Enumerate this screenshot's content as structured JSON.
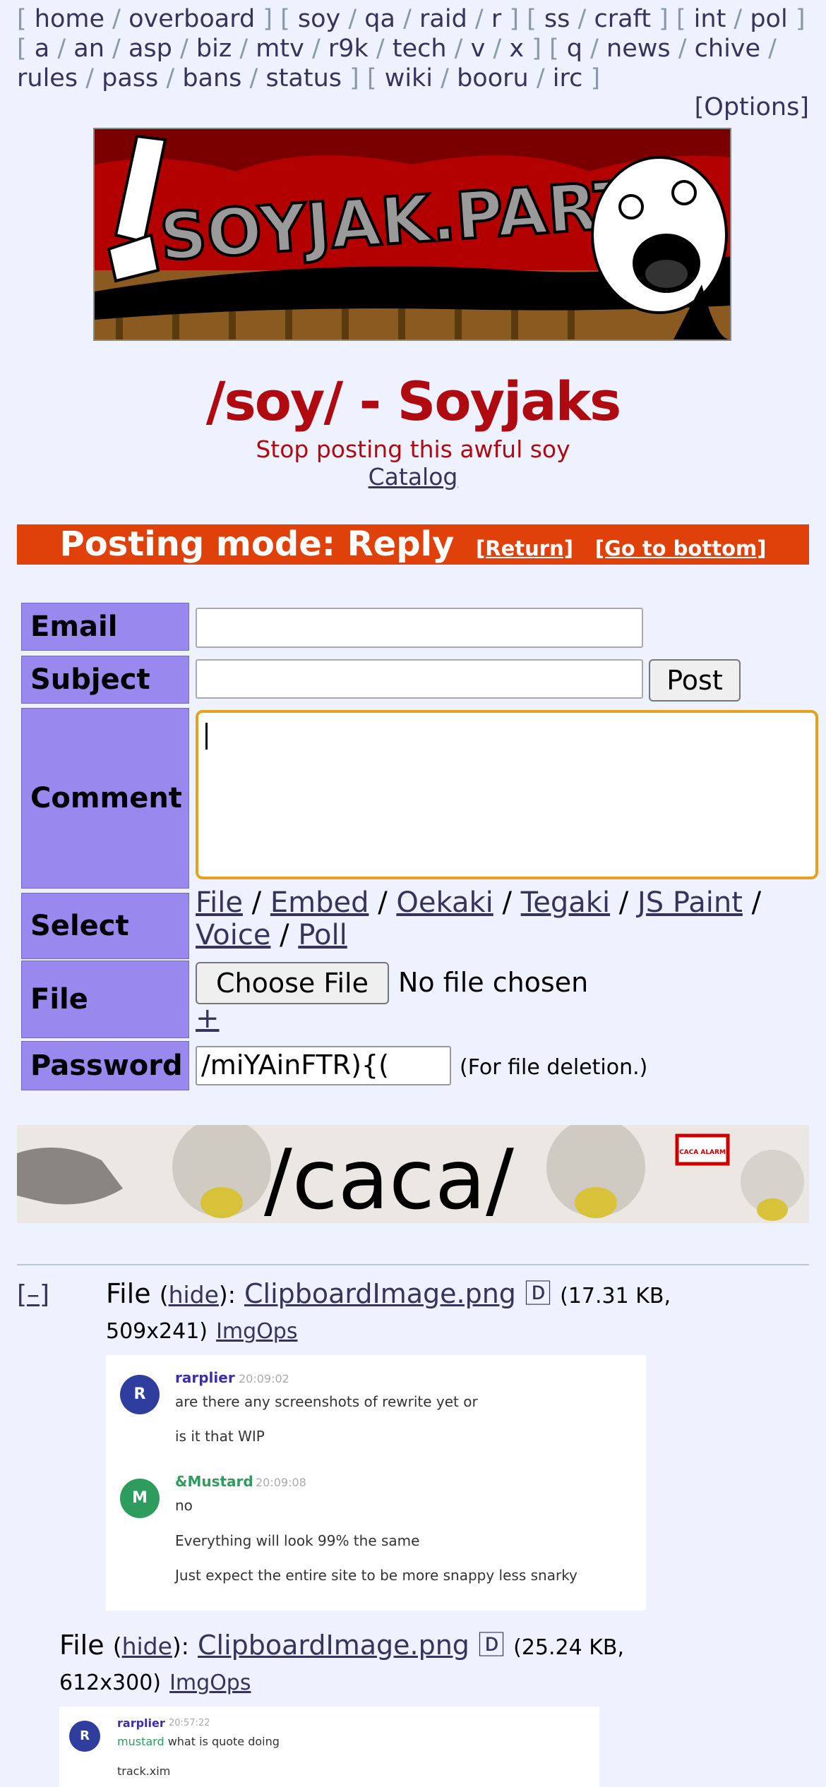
{
  "boardlist": {
    "groups": [
      [
        "home",
        "overboard"
      ],
      [
        "soy",
        "qa",
        "raid",
        "r"
      ],
      [
        "ss",
        "craft"
      ],
      [
        "int",
        "pol"
      ],
      [
        "a",
        "an",
        "asp",
        "biz",
        "mtv",
        "r9k",
        "tech",
        "v",
        "x"
      ],
      [
        "q",
        "news",
        "chive",
        "rules",
        "pass",
        "bans",
        "status"
      ],
      [
        "wiki",
        "booru",
        "irc"
      ]
    ],
    "options_label": "[Options]"
  },
  "banner": {
    "text": "SOYJAK.PARTY"
  },
  "board": {
    "title": "/soy/ - Soyjaks",
    "subtitle": "Stop posting this awful soy",
    "catalog_label": "Catalog"
  },
  "posting_mode": {
    "text": "Posting mode: Reply",
    "return_label": "[Return]",
    "bottom_label": "[Go to bottom]"
  },
  "form": {
    "email_label": "Email",
    "subject_label": "Subject",
    "post_button": "Post",
    "comment_label": "Comment",
    "select_label": "Select",
    "select_links": [
      "File",
      "Embed",
      "Oekaki",
      "Tegaki",
      "JS Paint",
      "Voice",
      "Poll"
    ],
    "file_label": "File",
    "choose_file": "Choose File",
    "no_file": "No file chosen",
    "add_file": "+",
    "password_label": "Password",
    "password_value": "/miYAinFTR){(",
    "password_note": "(For file deletion.)"
  },
  "board_banner": {
    "text": "/caca/",
    "sign_text": "CACA ALARM"
  },
  "thread": {
    "hide_thread": "[–]",
    "files": [
      {
        "prefix": "File",
        "hide": "hide",
        "name": "ClipboardImage.png",
        "download_icon": "🄳",
        "info_line1": "(17.31 KB,",
        "info_line2": "509x241)",
        "imgops": "ImgOps",
        "chat": [
          {
            "avatar": "R",
            "user": "rarplier",
            "time": "20:09:02",
            "lines": [
              "are there any screenshots of rewrite yet or",
              "is it that WIP"
            ],
            "color": "#2f3d9e",
            "name_color": "#3b2fae"
          },
          {
            "avatar": "M",
            "user": "&Mustard",
            "time": "20:09:08",
            "lines": [
              "no",
              "Everything will look 99% the same",
              "Just expect the entire site to be more snappy less snarky"
            ],
            "color": "#2e9c5c",
            "name_color": "#2e9c5c"
          }
        ]
      },
      {
        "prefix": "File",
        "hide": "hide",
        "name": "ClipboardImage.png",
        "download_icon": "🄳",
        "info_line1": "(25.24 KB,",
        "info_line2": "612x300)",
        "imgops": "ImgOps",
        "chat": [
          {
            "avatar": "R",
            "user": "rarplier",
            "time": "20:57:22",
            "mention": "mustard",
            "lines": [
              "what is quote doing",
              "track.xim"
            ],
            "color": "#2f3d9e",
            "name_color": "#3b2fae"
          }
        ]
      }
    ]
  },
  "colors": {
    "background": "#eef2ff",
    "title_red": "#af0a0f",
    "posting_bar": "#e0400a",
    "label_purple": "#9988ee",
    "link": "#34345c",
    "comment_focus": "#e6a11e"
  }
}
